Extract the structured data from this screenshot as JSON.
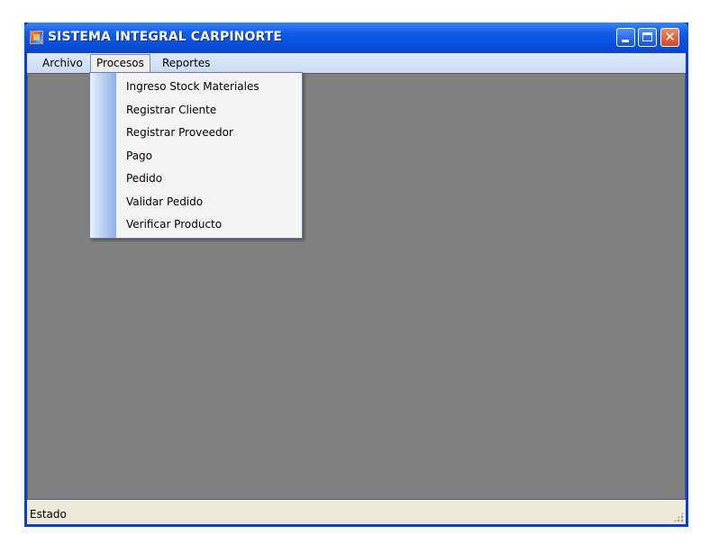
{
  "window": {
    "title": "SISTEMA INTEGRAL CARPINORTE",
    "icon": "app-form-icon"
  },
  "menubar": {
    "items": [
      {
        "label": "Archivo"
      },
      {
        "label": "Procesos"
      },
      {
        "label": "Reportes"
      }
    ]
  },
  "dropdown": {
    "items": [
      {
        "label": "Ingreso Stock Materiales"
      },
      {
        "label": "Registrar Cliente"
      },
      {
        "label": "Registrar Proveedor"
      },
      {
        "label": "Pago"
      },
      {
        "label": "Pedido"
      },
      {
        "label": "Validar Pedido"
      },
      {
        "label": "Verificar Producto"
      }
    ]
  },
  "statusbar": {
    "label": "Estado"
  },
  "colors": {
    "titlebar": "#0a4fd8",
    "mdi_background": "#808080",
    "menubar": "#d4e3f8",
    "close_button": "#d6461e"
  }
}
